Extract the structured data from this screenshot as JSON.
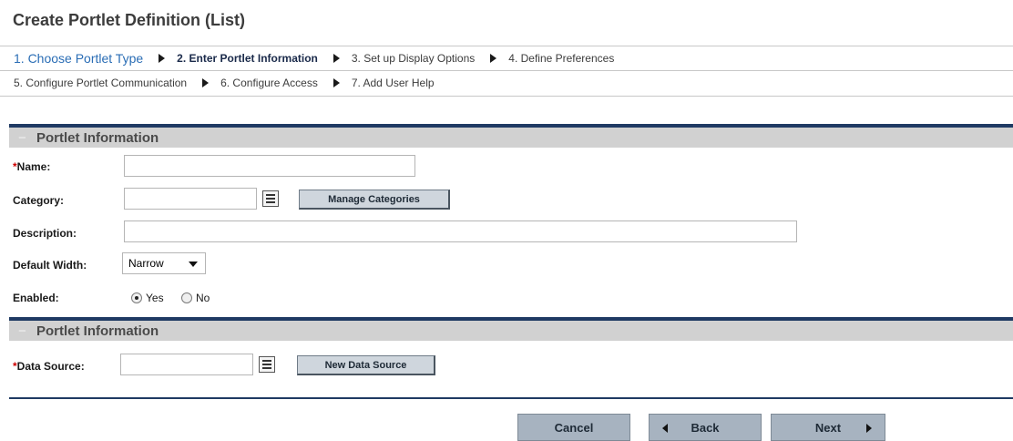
{
  "page_title": "Create Portlet Definition (List)",
  "steps_row1": [
    {
      "label": "1. Choose Portlet Type",
      "state": "link"
    },
    {
      "label": "2. Enter Portlet Information",
      "state": "current"
    },
    {
      "label": "3. Set up Display Options",
      "state": "pending"
    },
    {
      "label": "4. Define Preferences",
      "state": "pending"
    }
  ],
  "steps_row2": [
    {
      "label": "5. Configure Portlet Communication",
      "state": "pending"
    },
    {
      "label": "6. Configure Access",
      "state": "pending"
    },
    {
      "label": "7. Add User Help",
      "state": "pending"
    }
  ],
  "section1": {
    "collapse_symbol": "−",
    "title": "Portlet Information",
    "name": {
      "required_mark": "*",
      "label": "Name:",
      "value": ""
    },
    "category": {
      "label": "Category:",
      "value": "",
      "manage_button": "Manage Categories"
    },
    "description": {
      "label": "Description:",
      "value": ""
    },
    "default_width": {
      "label": "Default Width:",
      "selected": "Narrow"
    },
    "enabled": {
      "label": "Enabled:",
      "options": [
        "Yes",
        "No"
      ],
      "selected": "Yes"
    }
  },
  "section2": {
    "collapse_symbol": "−",
    "title": "Portlet Information",
    "data_source": {
      "required_mark": "*",
      "label": "Data Source:",
      "value": "",
      "new_button": "New Data Source"
    }
  },
  "footer": {
    "cancel": "Cancel",
    "back": "Back",
    "next": "Next"
  },
  "colors": {
    "section_border": "#1f3a63",
    "section_bg": "#d1d1d1",
    "link": "#2a6db5",
    "required": "#cc0000",
    "nav_button_bg": "#a7b3c0"
  }
}
